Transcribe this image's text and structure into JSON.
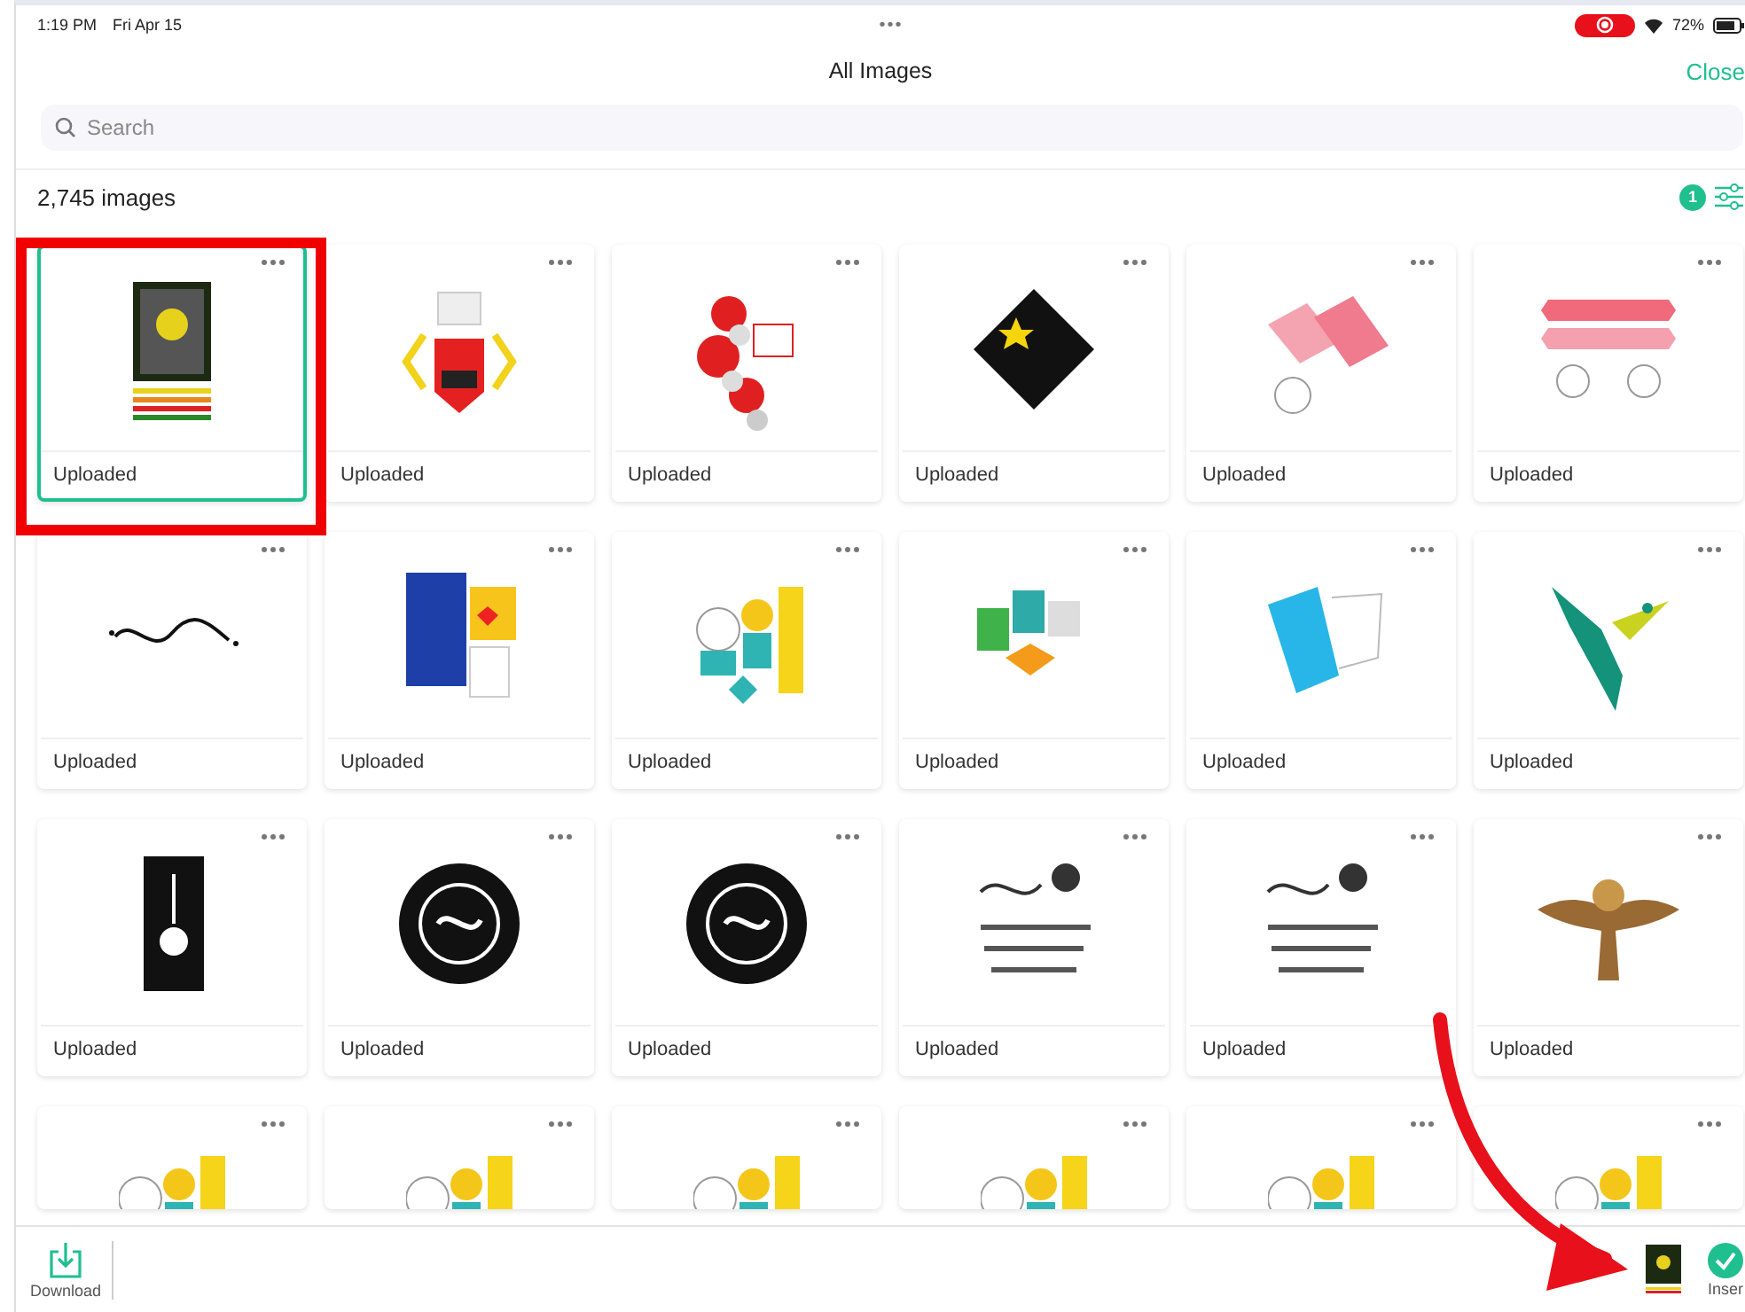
{
  "status_bar": {
    "time": "1:19 PM",
    "date": "Fri Apr 15",
    "handle": "•••",
    "recording": true,
    "battery_text": "72%"
  },
  "header": {
    "title": "All Images",
    "close": "Close"
  },
  "search": {
    "placeholder": "Search"
  },
  "summary": {
    "count": "2,745 images",
    "filter_badge": "1"
  },
  "tiles": [
    {
      "kind": "poster",
      "label": "Uploaded",
      "selected": true
    },
    {
      "kind": "jersey",
      "label": "Uploaded",
      "selected": false
    },
    {
      "kind": "roses",
      "label": "Uploaded",
      "selected": false
    },
    {
      "kind": "diamond",
      "label": "Uploaded",
      "selected": false
    },
    {
      "kind": "pink-box",
      "label": "Uploaded",
      "selected": false
    },
    {
      "kind": "pink-banner",
      "label": "Uploaded",
      "selected": false
    },
    {
      "kind": "script",
      "label": "Uploaded",
      "selected": false
    },
    {
      "kind": "blue-kit",
      "label": "Uploaded",
      "selected": false
    },
    {
      "kind": "unicorn",
      "label": "Uploaded",
      "selected": false
    },
    {
      "kind": "blocks",
      "label": "Uploaded",
      "selected": false
    },
    {
      "kind": "blue-box",
      "label": "Uploaded",
      "selected": false
    },
    {
      "kind": "bird",
      "label": "Uploaded",
      "selected": false
    },
    {
      "kind": "black-panel",
      "label": "Uploaded",
      "selected": false
    },
    {
      "kind": "black-circle",
      "label": "Uploaded",
      "selected": false
    },
    {
      "kind": "black-circle",
      "label": "Uploaded",
      "selected": false
    },
    {
      "kind": "sketch",
      "label": "Uploaded",
      "selected": false
    },
    {
      "kind": "sketch",
      "label": "Uploaded",
      "selected": false
    },
    {
      "kind": "owl",
      "label": "Uploaded",
      "selected": false
    },
    {
      "kind": "unicorn",
      "selected": false
    },
    {
      "kind": "unicorn",
      "selected": false
    },
    {
      "kind": "unicorn",
      "selected": false
    },
    {
      "kind": "unicorn",
      "selected": false
    },
    {
      "kind": "unicorn",
      "selected": false
    },
    {
      "kind": "unicorn",
      "selected": false
    }
  ],
  "toolbar": {
    "download": "Download",
    "insert": "Inser"
  }
}
